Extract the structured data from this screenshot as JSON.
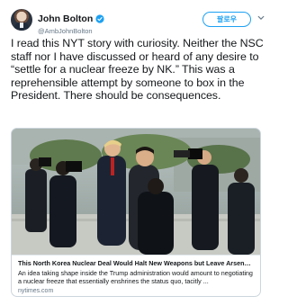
{
  "user": {
    "display_name": "John Bolton",
    "handle": "@AmbJohnBolton",
    "verified": true
  },
  "follow_button": {
    "label": "팔로우"
  },
  "tweet": {
    "text": "I read this NYT story with curiosity. Neither the NSC staff nor I have discussed or heard of any desire to “settle for a nuclear freeze by NK.”  This was a reprehensible attempt by someone to box in the President. There should be consequences."
  },
  "card": {
    "title": "This North Korea Nuclear Deal Would Halt New Weapons but Leave Arsenal I...",
    "description": "An idea taking shape inside the Trump administration would amount to negotiating a nuclear freeze that essentially enshrines the status quo, tacitly ...",
    "domain": "nytimes.com"
  },
  "icons": {
    "verified": "verified-badge-icon",
    "caret": "chevron-down-icon"
  },
  "colors": {
    "accent": "#1da1f2",
    "text": "#14171a",
    "secondary": "#657786",
    "border": "#ccd6dd"
  }
}
